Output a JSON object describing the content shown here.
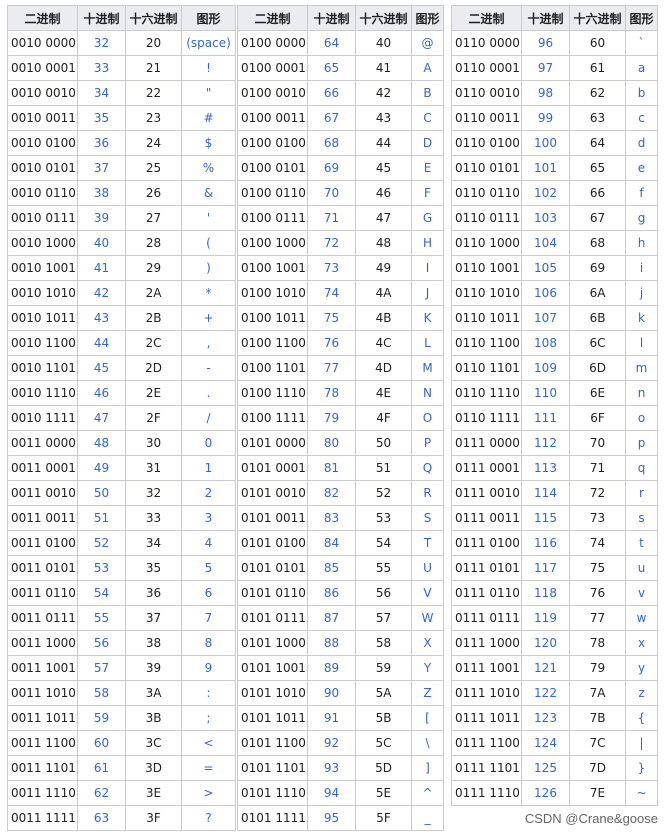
{
  "headers": {
    "binary": "二进制",
    "decimal": "十进制",
    "hex": "十六进制",
    "glyph": "图形"
  },
  "tables": [
    {
      "rows": [
        [
          "0010 0000",
          "32",
          "20",
          "(space)"
        ],
        [
          "0010 0001",
          "33",
          "21",
          "!"
        ],
        [
          "0010 0010",
          "34",
          "22",
          "\""
        ],
        [
          "0010 0011",
          "35",
          "23",
          "#"
        ],
        [
          "0010 0100",
          "36",
          "24",
          "$"
        ],
        [
          "0010 0101",
          "37",
          "25",
          "%"
        ],
        [
          "0010 0110",
          "38",
          "26",
          "&"
        ],
        [
          "0010 0111",
          "39",
          "27",
          "'"
        ],
        [
          "0010 1000",
          "40",
          "28",
          "("
        ],
        [
          "0010 1001",
          "41",
          "29",
          ")"
        ],
        [
          "0010 1010",
          "42",
          "2A",
          "*"
        ],
        [
          "0010 1011",
          "43",
          "2B",
          "+"
        ],
        [
          "0010 1100",
          "44",
          "2C",
          ","
        ],
        [
          "0010 1101",
          "45",
          "2D",
          "-"
        ],
        [
          "0010 1110",
          "46",
          "2E",
          "."
        ],
        [
          "0010 1111",
          "47",
          "2F",
          "/"
        ],
        [
          "0011 0000",
          "48",
          "30",
          "0"
        ],
        [
          "0011 0001",
          "49",
          "31",
          "1"
        ],
        [
          "0011 0010",
          "50",
          "32",
          "2"
        ],
        [
          "0011 0011",
          "51",
          "33",
          "3"
        ],
        [
          "0011 0100",
          "52",
          "34",
          "4"
        ],
        [
          "0011 0101",
          "53",
          "35",
          "5"
        ],
        [
          "0011 0110",
          "54",
          "36",
          "6"
        ],
        [
          "0011 0111",
          "55",
          "37",
          "7"
        ],
        [
          "0011 1000",
          "56",
          "38",
          "8"
        ],
        [
          "0011 1001",
          "57",
          "39",
          "9"
        ],
        [
          "0011 1010",
          "58",
          "3A",
          ":"
        ],
        [
          "0011 1011",
          "59",
          "3B",
          ";"
        ],
        [
          "0011 1100",
          "60",
          "3C",
          "<"
        ],
        [
          "0011 1101",
          "61",
          "3D",
          "="
        ],
        [
          "0011 1110",
          "62",
          "3E",
          ">"
        ],
        [
          "0011 1111",
          "63",
          "3F",
          "?"
        ]
      ]
    },
    {
      "rows": [
        [
          "0100 0000",
          "64",
          "40",
          "@"
        ],
        [
          "0100 0001",
          "65",
          "41",
          "A"
        ],
        [
          "0100 0010",
          "66",
          "42",
          "B"
        ],
        [
          "0100 0011",
          "67",
          "43",
          "C"
        ],
        [
          "0100 0100",
          "68",
          "44",
          "D"
        ],
        [
          "0100 0101",
          "69",
          "45",
          "E"
        ],
        [
          "0100 0110",
          "70",
          "46",
          "F"
        ],
        [
          "0100 0111",
          "71",
          "47",
          "G"
        ],
        [
          "0100 1000",
          "72",
          "48",
          "H"
        ],
        [
          "0100 1001",
          "73",
          "49",
          "I"
        ],
        [
          "0100 1010",
          "74",
          "4A",
          "J"
        ],
        [
          "0100 1011",
          "75",
          "4B",
          "K"
        ],
        [
          "0100 1100",
          "76",
          "4C",
          "L"
        ],
        [
          "0100 1101",
          "77",
          "4D",
          "M"
        ],
        [
          "0100 1110",
          "78",
          "4E",
          "N"
        ],
        [
          "0100 1111",
          "79",
          "4F",
          "O"
        ],
        [
          "0101 0000",
          "80",
          "50",
          "P"
        ],
        [
          "0101 0001",
          "81",
          "51",
          "Q"
        ],
        [
          "0101 0010",
          "82",
          "52",
          "R"
        ],
        [
          "0101 0011",
          "83",
          "53",
          "S"
        ],
        [
          "0101 0100",
          "84",
          "54",
          "T"
        ],
        [
          "0101 0101",
          "85",
          "55",
          "U"
        ],
        [
          "0101 0110",
          "86",
          "56",
          "V"
        ],
        [
          "0101 0111",
          "87",
          "57",
          "W"
        ],
        [
          "0101 1000",
          "88",
          "58",
          "X"
        ],
        [
          "0101 1001",
          "89",
          "59",
          "Y"
        ],
        [
          "0101 1010",
          "90",
          "5A",
          "Z"
        ],
        [
          "0101 1011",
          "91",
          "5B",
          "["
        ],
        [
          "0101 1100",
          "92",
          "5C",
          "\\"
        ],
        [
          "0101 1101",
          "93",
          "5D",
          "]"
        ],
        [
          "0101 1110",
          "94",
          "5E",
          "^"
        ],
        [
          "0101 1111",
          "95",
          "5F",
          "_"
        ]
      ]
    },
    {
      "rows": [
        [
          "0110 0000",
          "96",
          "60",
          "`"
        ],
        [
          "0110 0001",
          "97",
          "61",
          "a"
        ],
        [
          "0110 0010",
          "98",
          "62",
          "b"
        ],
        [
          "0110 0011",
          "99",
          "63",
          "c"
        ],
        [
          "0110 0100",
          "100",
          "64",
          "d"
        ],
        [
          "0110 0101",
          "101",
          "65",
          "e"
        ],
        [
          "0110 0110",
          "102",
          "66",
          "f"
        ],
        [
          "0110 0111",
          "103",
          "67",
          "g"
        ],
        [
          "0110 1000",
          "104",
          "68",
          "h"
        ],
        [
          "0110 1001",
          "105",
          "69",
          "i"
        ],
        [
          "0110 1010",
          "106",
          "6A",
          "j"
        ],
        [
          "0110 1011",
          "107",
          "6B",
          "k"
        ],
        [
          "0110 1100",
          "108",
          "6C",
          "l"
        ],
        [
          "0110 1101",
          "109",
          "6D",
          "m"
        ],
        [
          "0110 1110",
          "110",
          "6E",
          "n"
        ],
        [
          "0110 1111",
          "111",
          "6F",
          "o"
        ],
        [
          "0111 0000",
          "112",
          "70",
          "p"
        ],
        [
          "0111 0001",
          "113",
          "71",
          "q"
        ],
        [
          "0111 0010",
          "114",
          "72",
          "r"
        ],
        [
          "0111 0011",
          "115",
          "73",
          "s"
        ],
        [
          "0111 0100",
          "116",
          "74",
          "t"
        ],
        [
          "0111 0101",
          "117",
          "75",
          "u"
        ],
        [
          "0111 0110",
          "118",
          "76",
          "v"
        ],
        [
          "0111 0111",
          "119",
          "77",
          "w"
        ],
        [
          "0111 1000",
          "120",
          "78",
          "x"
        ],
        [
          "0111 1001",
          "121",
          "79",
          "y"
        ],
        [
          "0111 1010",
          "122",
          "7A",
          "z"
        ],
        [
          "0111 1011",
          "123",
          "7B",
          "{"
        ],
        [
          "0111 1100",
          "124",
          "7C",
          "|"
        ],
        [
          "0111 1101",
          "125",
          "7D",
          "}"
        ],
        [
          "0111 1110",
          "126",
          "7E",
          "~"
        ]
      ]
    }
  ],
  "watermark": "CSDN @Crane&goose",
  "colors": {
    "header_bg": "#eaecf0",
    "border": "#c8ccd1",
    "link_blue": "#3366cc"
  }
}
